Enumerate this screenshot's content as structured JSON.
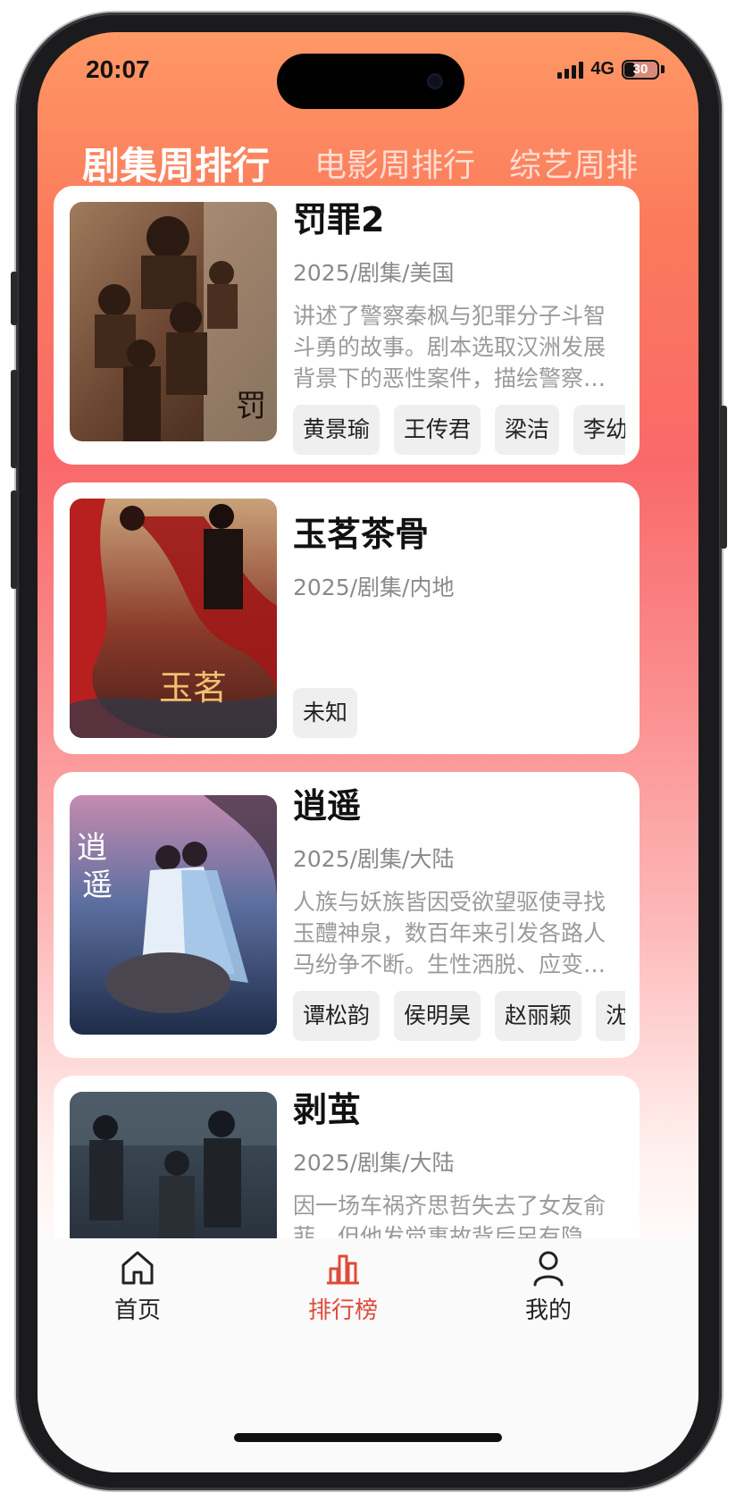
{
  "status_bar": {
    "time": "20:07",
    "network": "4G",
    "battery": "30"
  },
  "tabs": [
    {
      "label": "剧集周排行",
      "active": true
    },
    {
      "label": "电影周排行",
      "active": false
    },
    {
      "label": "综艺周排",
      "active": false
    }
  ],
  "items": [
    {
      "title": "罚罪2",
      "meta": "2025/剧集/美国",
      "desc": "讲述了警察秦枫与犯罪分子斗智斗勇的故事。剧本选取汉洲发展背景下的恶性案件，描绘警察…",
      "tags": [
        "黄景瑜",
        "王传君",
        "梁洁",
        "李幼"
      ]
    },
    {
      "title": "玉茗茶骨",
      "meta": "2025/剧集/内地",
      "desc": "",
      "tags": [
        "未知"
      ]
    },
    {
      "title": "逍遥",
      "meta": "2025/剧集/大陆",
      "desc": "人族与妖族皆因受欲望驱使寻找玉醴神泉，数百年来引发各路人马纷争不断。生性洒脱、应变…",
      "tags": [
        "谭松韵",
        "侯明昊",
        "赵丽颖",
        "沈"
      ]
    },
    {
      "title": "剥茧",
      "meta": "2025/剧集/大陆",
      "desc": "因一场车祸齐思哲失去了女友俞菲，但他发觉事故背后另有隐…",
      "tags": []
    }
  ],
  "bottom_nav": [
    {
      "label": "首页",
      "icon": "home-icon",
      "active": false
    },
    {
      "label": "排行榜",
      "icon": "ranking-icon",
      "active": true
    },
    {
      "label": "我的",
      "icon": "user-icon",
      "active": false
    }
  ],
  "colors": {
    "accent": "#e04a3a",
    "header_gradient_top": "#ff9865",
    "header_gradient_mid": "#f9696a"
  }
}
